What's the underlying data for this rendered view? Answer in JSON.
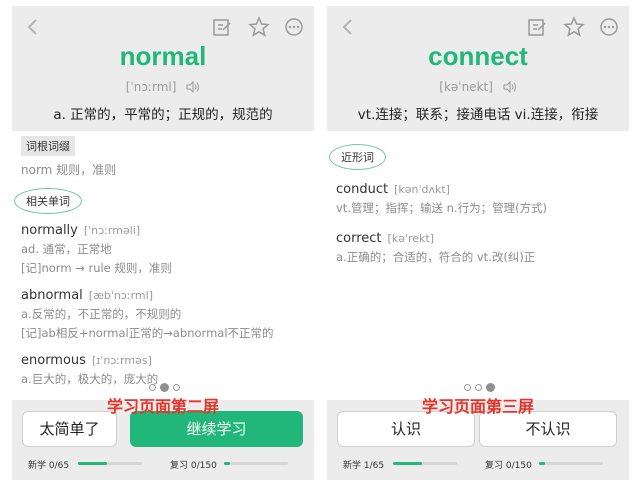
{
  "left": {
    "word": "normal",
    "phonetic": "[ˈnɔːrml]",
    "definition": "a. 正常的，平常的；正规的，规范的",
    "root_tag": "词根词缀",
    "root_text": "norm  规则，准则",
    "related_tag": "相关单词",
    "entries": [
      {
        "word": "normally",
        "phonetic": "[ˈnɔːrməli]",
        "lines": [
          "ad. 通常，正常地",
          "[记]norm → rule 规则，准则"
        ]
      },
      {
        "word": "abnormal",
        "phonetic": "[æbˈnɔːrml]",
        "lines": [
          "a.反常的，不正常的，不规则的",
          "[记]ab相反+normal正常的→abnormal不正常的"
        ]
      },
      {
        "word": "enormous",
        "phonetic": "[ɪˈnɔːrməs]",
        "lines": [
          "a.巨大的，极大的，庞大的"
        ]
      }
    ],
    "caption": "学习页面第二屏",
    "btn_easy": "太简单了",
    "btn_continue": "继续学习",
    "new_label": "新学 0/65",
    "review_label": "复习 0/150",
    "new_progress": 0.45,
    "review_progress": 0.1,
    "active_page": 2
  },
  "right": {
    "word": "connect",
    "phonetic": "[kəˈnekt]",
    "definition": "vt.连接；联系；接通电话 vi.连接，衔接",
    "similar_tag": "近形词",
    "entries": [
      {
        "word": "conduct",
        "phonetic": "[kənˈdʌkt]",
        "lines": [
          "vt.管理；指挥；输送 n.行为；管理(方式)"
        ]
      },
      {
        "word": "correct",
        "phonetic": "[kəˈrekt]",
        "lines": [
          "a.正确的；合适的，符合的 vt.改(纠)正"
        ]
      }
    ],
    "caption": "学习页面第三屏",
    "btn_know": "认识",
    "btn_dontknow": "不认识",
    "new_label": "新学 1/65",
    "review_label": "复习 0/150",
    "new_progress": 0.45,
    "review_progress": 0.1,
    "active_page": 3
  },
  "icons": [
    "back-icon",
    "edit-icon",
    "star-icon",
    "more-icon",
    "speaker-icon"
  ],
  "colors": {
    "accent": "#22b77a",
    "caption_red": "#e7342b",
    "header_bg": "#ececec"
  }
}
